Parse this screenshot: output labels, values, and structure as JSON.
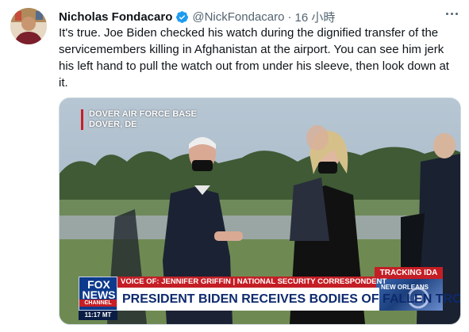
{
  "author": {
    "name": "Nicholas Fondacaro",
    "handle": "@NickFondacaro",
    "time": "16 小時",
    "separator": "·",
    "verified": true,
    "avatar_icon": "avatar-photo"
  },
  "tweet": {
    "text": "It's true. Joe Biden checked his watch during the dignified transfer of the servicemembers killing in Afghanistan at the airport. You can see him jerk his left hand to pull the watch out from under his sleeve, then look down at it."
  },
  "media": {
    "location_line1": "DOVER AIR FORCE BASE",
    "location_line2": "DOVER, DE",
    "logo_line1": "FOX",
    "logo_line2": "NEWS",
    "channel_sub": "CHANNEL",
    "timestamp": "11:17 MT",
    "voice_bar": "VOICE OF: JENNIFER GRIFFIN | NATIONAL SECURITY CORRESPONDENT",
    "headline": "PRESIDENT BIDEN RECEIVES BODIES OF FALLEN TROOPS",
    "tracking_label": "TRACKING IDA",
    "tracking_city": "NEW ORLEANS"
  },
  "colors": {
    "verified": "#1d9bf0",
    "fox_red": "#c41e25",
    "fox_blue": "#0d3a8c"
  }
}
